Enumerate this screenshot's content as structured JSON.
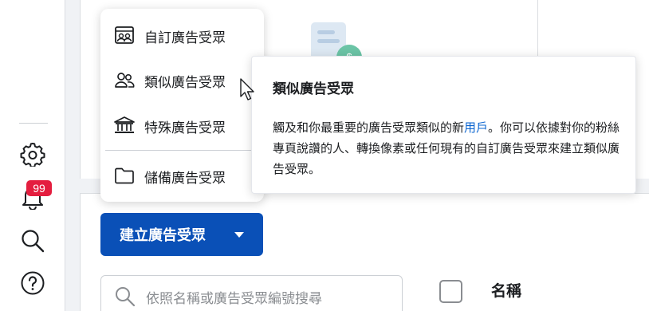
{
  "rail": {
    "notifications_count": "99",
    "items": [
      {
        "icon": "gear-icon"
      },
      {
        "icon": "bell-icon"
      },
      {
        "icon": "search-icon"
      },
      {
        "icon": "help-icon"
      }
    ]
  },
  "menu": {
    "items": [
      {
        "label": "自訂廣告受眾",
        "icon": "custom-audience-icon"
      },
      {
        "label": "類似廣告受眾",
        "icon": "people-icon"
      },
      {
        "label": "特殊廣告受眾",
        "icon": "institution-icon"
      },
      {
        "label": "儲備廣告受眾",
        "icon": "folder-icon"
      }
    ]
  },
  "tooltip": {
    "title": "類似廣告受眾",
    "body_prefix": "觸及和你最重要的廣告受眾類似的新",
    "body_link": "用戶",
    "body_suffix": "。你可以依據對你的粉絲專頁說讚的人、轉換像素或任何現有的自訂廣告受眾來建立類似廣告受眾。"
  },
  "toolbar": {
    "create_label": "建立廣告受眾"
  },
  "search": {
    "placeholder": "依照名稱或廣告受眾編號搜尋"
  },
  "table": {
    "column_name": "名稱"
  },
  "colors": {
    "primary": "#0a50b7",
    "link": "#0a64d0",
    "badge": "#e41e3f"
  }
}
